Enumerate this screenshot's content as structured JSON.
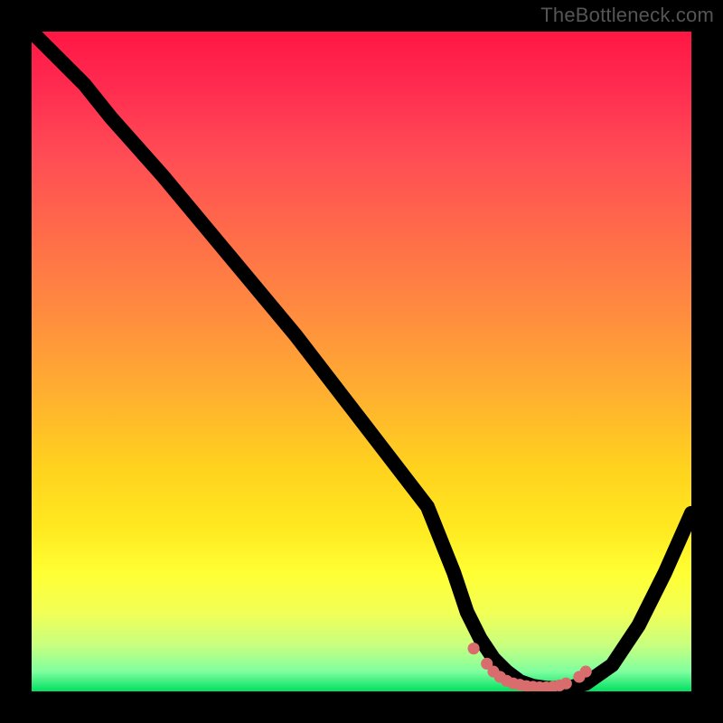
{
  "watermark": "TheBottleneck.com",
  "chart_data": {
    "type": "line",
    "title": "",
    "xlabel": "",
    "ylabel": "",
    "xlim": [
      0,
      100
    ],
    "ylim": [
      0,
      100
    ],
    "series": [
      {
        "name": "curve",
        "x": [
          0,
          4,
          8,
          12,
          20,
          30,
          40,
          50,
          60,
          64,
          66,
          68,
          70,
          72,
          74,
          76,
          78,
          80,
          82,
          84,
          88,
          92,
          96,
          100
        ],
        "y": [
          100,
          96,
          92,
          87,
          78,
          66,
          54,
          41,
          28,
          18,
          12,
          8,
          5,
          3,
          1.5,
          0.8,
          0.5,
          0.5,
          0.7,
          1.2,
          4,
          10,
          18,
          27
        ]
      }
    ],
    "markers": {
      "name": "flat-region-dots",
      "x": [
        67,
        69,
        70,
        71,
        72,
        73,
        74,
        75,
        76,
        77,
        78,
        79,
        80,
        81,
        83,
        84
      ],
      "y": [
        6.5,
        4.2,
        3.0,
        2.2,
        1.6,
        1.2,
        1.0,
        0.8,
        0.7,
        0.6,
        0.6,
        0.7,
        0.9,
        1.2,
        2.2,
        3.0
      ]
    },
    "background_gradient": {
      "direction": "vertical",
      "stops": [
        {
          "pos": 0.0,
          "color": "#ff1744"
        },
        {
          "pos": 0.5,
          "color": "#ffb030"
        },
        {
          "pos": 0.82,
          "color": "#ffff33"
        },
        {
          "pos": 1.0,
          "color": "#00e060"
        }
      ]
    }
  }
}
